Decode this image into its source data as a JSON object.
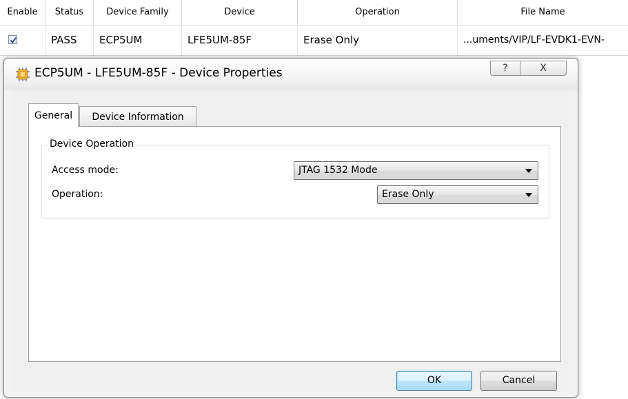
{
  "table": {
    "headers": {
      "enable": "Enable",
      "status": "Status",
      "device_family": "Device Family",
      "device": "Device",
      "operation": "Operation",
      "file_name": "File Name"
    },
    "row": {
      "enabled": true,
      "status": "PASS",
      "device_family": "ECP5UM",
      "device": "LFE5UM-85F",
      "operation": "Erase Only",
      "file_name": "...uments/VIP/LF-EVDK1-EVN-"
    }
  },
  "dialog": {
    "title": "ECP5UM - LFE5UM-85F - Device Properties",
    "help_glyph": "?",
    "close_glyph": "X",
    "tabs": [
      "General",
      "Device Information"
    ],
    "active_tab": "General",
    "group_title": "Device Operation",
    "access_mode_label": "Access mode:",
    "access_mode_value": "JTAG 1532 Mode",
    "operation_label": "Operation:",
    "operation_value": "Erase Only",
    "ok_label": "OK",
    "cancel_label": "Cancel"
  },
  "colors": {
    "ok_button_border": "#3c7fb1",
    "dialog_background": "#f0f0f0"
  },
  "icons": {
    "app": "device-chip-icon",
    "checkbox": "checkmark-icon",
    "dropdown": "chevron-down-icon"
  }
}
